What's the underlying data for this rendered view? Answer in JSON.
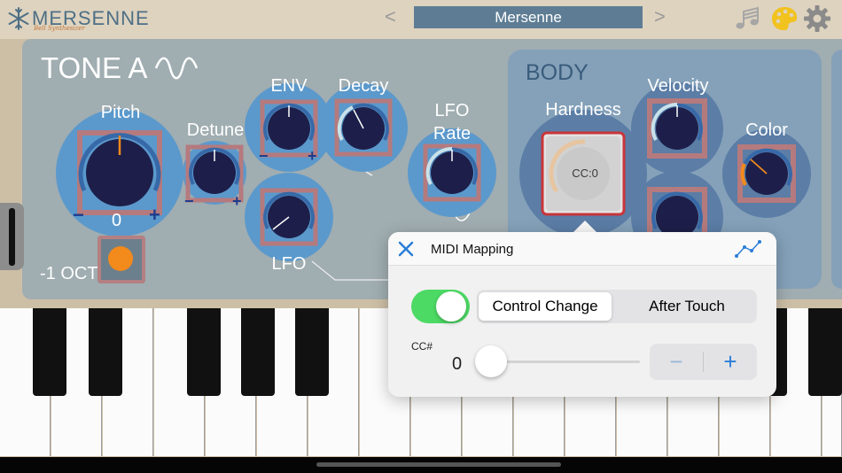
{
  "header": {
    "logo_title": "MERSENNE",
    "logo_subtitle": "Bell Synthesizer",
    "preset_name": "Mersenne",
    "prev_glyph": "<",
    "next_glyph": ">",
    "icons": [
      "snowflake-icon",
      "music-notes-icon",
      "palette-icon",
      "gear-icon"
    ]
  },
  "tone": {
    "title": "TONE A",
    "knobs": {
      "pitch": {
        "label": "Pitch",
        "value": "0",
        "minus": "−",
        "plus": "+"
      },
      "detune": {
        "label": "Detune",
        "minus": "−",
        "plus": "+"
      },
      "env": {
        "label": "ENV",
        "minus": "−",
        "plus": "+"
      },
      "decay": {
        "label": "Decay"
      },
      "lfo": {
        "label": "LFO"
      },
      "lfo_rate": {
        "label_line1": "LFO",
        "label_line2": "Rate"
      }
    },
    "octave_label": "-1 OCT."
  },
  "body": {
    "title": "BODY",
    "knobs": {
      "hardness": {
        "label": "Hardness",
        "cc_text": "CC:0"
      },
      "velocity": {
        "label": "Velocity"
      },
      "color": {
        "label": "Color"
      }
    }
  },
  "midi_popover": {
    "title": "MIDI Mapping",
    "toggle_on": true,
    "segments": [
      "Control Change",
      "After Touch"
    ],
    "selected_segment": "Control Change",
    "cc_label": "CC#",
    "cc_value": "0",
    "stepper_minus": "−",
    "stepper_plus": "+"
  },
  "colors": {
    "panel": "#a0adb1",
    "body_section": "#84a1b9",
    "knob_ring": "#5b99cc",
    "knob_body": "#1d1f4a",
    "knob_square": "#b57a7e",
    "accent_orange": "#f28a1c",
    "toggle_green": "#4cd964",
    "ios_blue": "#2a7ed8"
  }
}
